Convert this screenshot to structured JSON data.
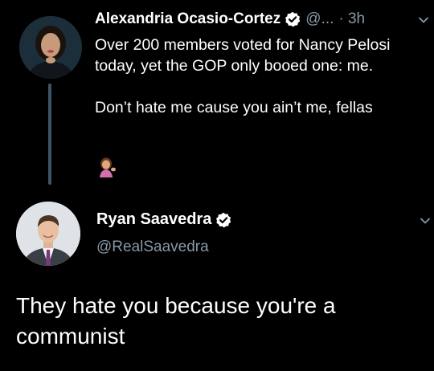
{
  "tweet": {
    "author_name": "Alexandria Ocasio-Cortez",
    "handle_truncated": "@...",
    "time": "· 3h",
    "text_line1": "Over 200 members voted for Nancy Pelosi today, yet the GOP only booed one: me.",
    "text_line2": "Don’t hate me cause you ain’t me, fellas",
    "emoji_icon": "woman-tipping-hand-emoji",
    "verified_icon": "verified-badge-icon",
    "menu_icon": "chevron-down-icon"
  },
  "reply": {
    "author_name": "Ryan Saavedra",
    "handle": "@RealSaavedra",
    "text": "They hate you because you're a communist",
    "verified_icon": "verified-badge-icon",
    "menu_icon": "chevron-down-icon"
  },
  "colors": {
    "background": "#000000",
    "text": "#ffffff",
    "secondary_text": "#8899a6",
    "thread_line": "#3d5466"
  }
}
